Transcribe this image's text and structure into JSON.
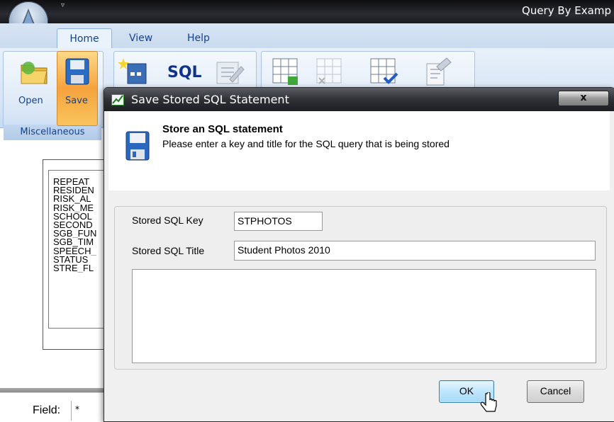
{
  "app": {
    "title": "Query By Examp",
    "qat_glyph": "▿",
    "tabs": [
      "Home",
      "View",
      "Help"
    ],
    "ribbon": {
      "open_label": "Open",
      "save_label": "Save",
      "sql_label": "SQL",
      "group_label": "Miscellaneous"
    }
  },
  "background": {
    "list_items": [
      "REPEAT",
      "RESIDEN",
      "RISK_AL",
      "RISK_ME",
      "SCHOOL",
      "SECOND",
      "SGB_FUN",
      "SGB_TIM",
      "SPEECH_",
      "STATUS",
      "STRE_FL"
    ],
    "field_label": "Field:",
    "field_value": "*"
  },
  "dialog": {
    "title": "Save Stored SQL Statement",
    "close_glyph": "x",
    "header_title": "Store an SQL statement",
    "header_subtitle": "Please enter a key and title for the SQL query that is being stored",
    "key_label": "Stored SQL Key",
    "key_value": "STPHOTOS",
    "title_label": "Stored SQL Title",
    "title_value": "Student Photos 2010",
    "ok_label": "OK",
    "cancel_label": "Cancel"
  },
  "colors": {
    "ribbon_text": "#15428b",
    "save_highlight": "#f6a33d",
    "ok_border": "#3c7fb1"
  }
}
